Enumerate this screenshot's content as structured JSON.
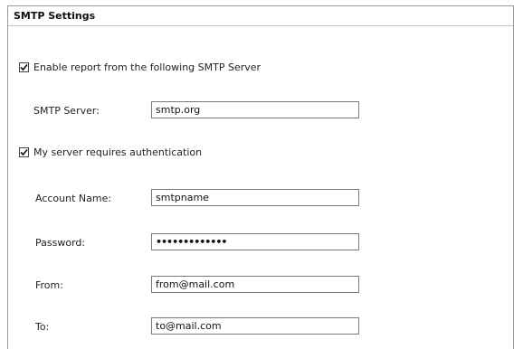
{
  "section": {
    "title": "SMTP Settings"
  },
  "enable_report": {
    "checked": true,
    "label": "Enable report from the following SMTP Server"
  },
  "smtp_server": {
    "label": "SMTP Server:",
    "value": "smtp.org"
  },
  "require_auth": {
    "checked": true,
    "label": "My server requires authentication"
  },
  "account_name": {
    "label": "Account Name:",
    "value": "smtpname"
  },
  "password": {
    "label": "Password:",
    "value": "•••••••••••••"
  },
  "from": {
    "label": "From:",
    "value": "from@mail.com"
  },
  "to": {
    "label": "To:",
    "value": "to@mail.com"
  }
}
